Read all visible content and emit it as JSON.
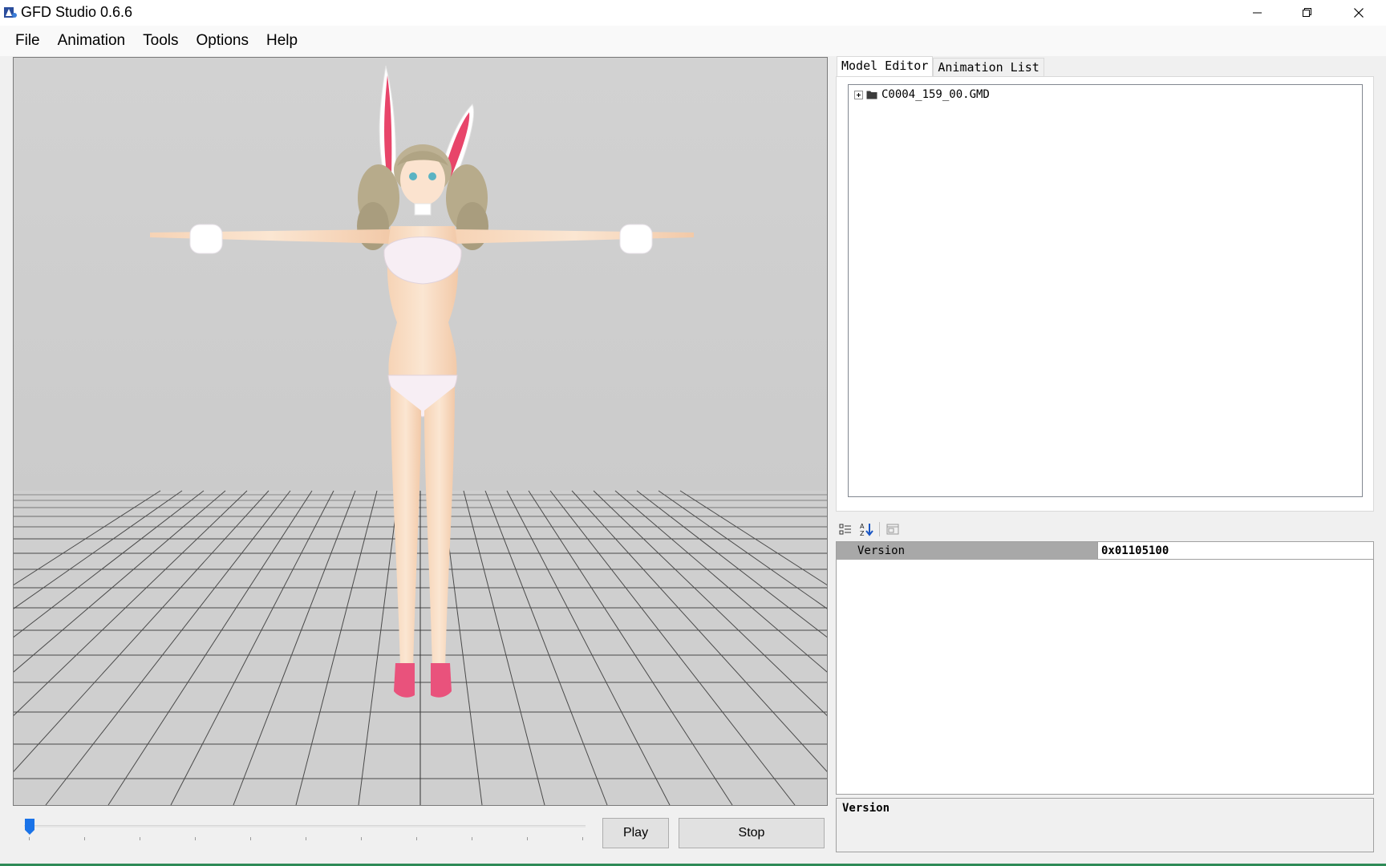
{
  "window": {
    "title": "GFD Studio 0.6.6",
    "minimize_icon": "minimize-icon",
    "maximize_icon": "restore-icon",
    "close_icon": "close-icon"
  },
  "menu": {
    "items": [
      "File",
      "Animation",
      "Tools",
      "Options",
      "Help"
    ]
  },
  "viewport": {
    "background_color": "#d0d0d0",
    "grid_color": "#4a4a4a",
    "content": "3d-model-preview"
  },
  "playback": {
    "position": 0,
    "play_label": "Play",
    "stop_label": "Stop"
  },
  "tabs": {
    "model_editor": "Model Editor",
    "animation_list": "Animation List"
  },
  "tree": {
    "root_label": "C0004_159_00.GMD",
    "root_icon": "folder-icon"
  },
  "property_grid": {
    "toolbar_icons": [
      "categorized-icon",
      "alphabetical-sort-icon",
      "property-pages-icon"
    ],
    "rows": [
      {
        "name": "Version",
        "value": "0x01105100"
      }
    ],
    "description_title": "Version"
  },
  "colors": {
    "selected_row": "#a8a8a8",
    "thumb": "#1a73e8",
    "accent_bottom": "#2e8b57"
  }
}
